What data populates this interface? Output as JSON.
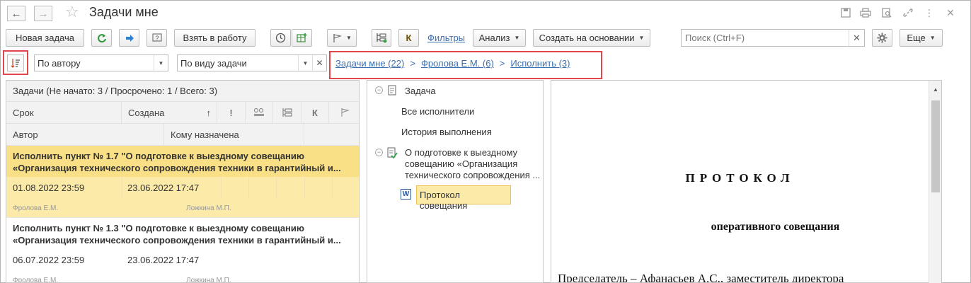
{
  "window": {
    "title": "Задачи мне"
  },
  "toolbar": {
    "new_task": "Новая задача",
    "take_to_work": "Взять в работу",
    "k_label": "К",
    "filters": "Фильтры",
    "analysis": "Анализ",
    "create_based": "Создать на основании",
    "search_placeholder": "Поиск (Ctrl+F)",
    "more": "Еще"
  },
  "filters": {
    "group_by": "По автору",
    "task_kind": "По виду задачи"
  },
  "breadcrumbs": [
    "Задачи мне (22)",
    "Фролова Е.М. (6)",
    "Исполнить (3)"
  ],
  "breadcrumb_separator": ">",
  "task_list": {
    "header": "Задачи (Не начато: 3 / Просрочено: 1 / Всего: 3)",
    "columns": {
      "due": "Срок",
      "created": "Создана",
      "sort_arrow": "↑",
      "priority": "!",
      "k": "К",
      "author": "Автор",
      "assignee": "Кому назначена"
    },
    "items": [
      {
        "subject": "Исполнить пункт № 1.7 \"О подготовке к выездному совещанию «Организация технического сопровождения техники в гарантийный и...",
        "due": "01.08.2022 23:59",
        "created": "23.06.2022 17:47",
        "author": "Фролова Е.М.",
        "assignee": "Ложкина М.П.",
        "selected": true
      },
      {
        "subject": "Исполнить пункт № 1.3 \"О подготовке к выездному совещанию «Организация технического сопровождения техники в гарантийный и...",
        "due": "06.07.2022 23:59",
        "created": "23.06.2022 17:47",
        "author": "Фролова Е.М.",
        "assignee": "Ложкина М.П.",
        "selected": false
      }
    ]
  },
  "tree": {
    "task": "Задача",
    "all_executors": "Все исполнители",
    "history": "История выполнения",
    "subject": "О подготовке к выездному совещанию «Организация технического сопровождения ...",
    "document": "Протокол совещания"
  },
  "preview": {
    "title": "ПРОТОКОЛ",
    "subtitle": "оперативного совещания",
    "line1": "Председатель – Афанасьев А.С., заместитель директора"
  },
  "colors": {
    "selected_row": "#fbeaa8",
    "selected_subject": "#f9df85",
    "link": "#3a6fb0",
    "highlight_border": "#e0474b"
  }
}
